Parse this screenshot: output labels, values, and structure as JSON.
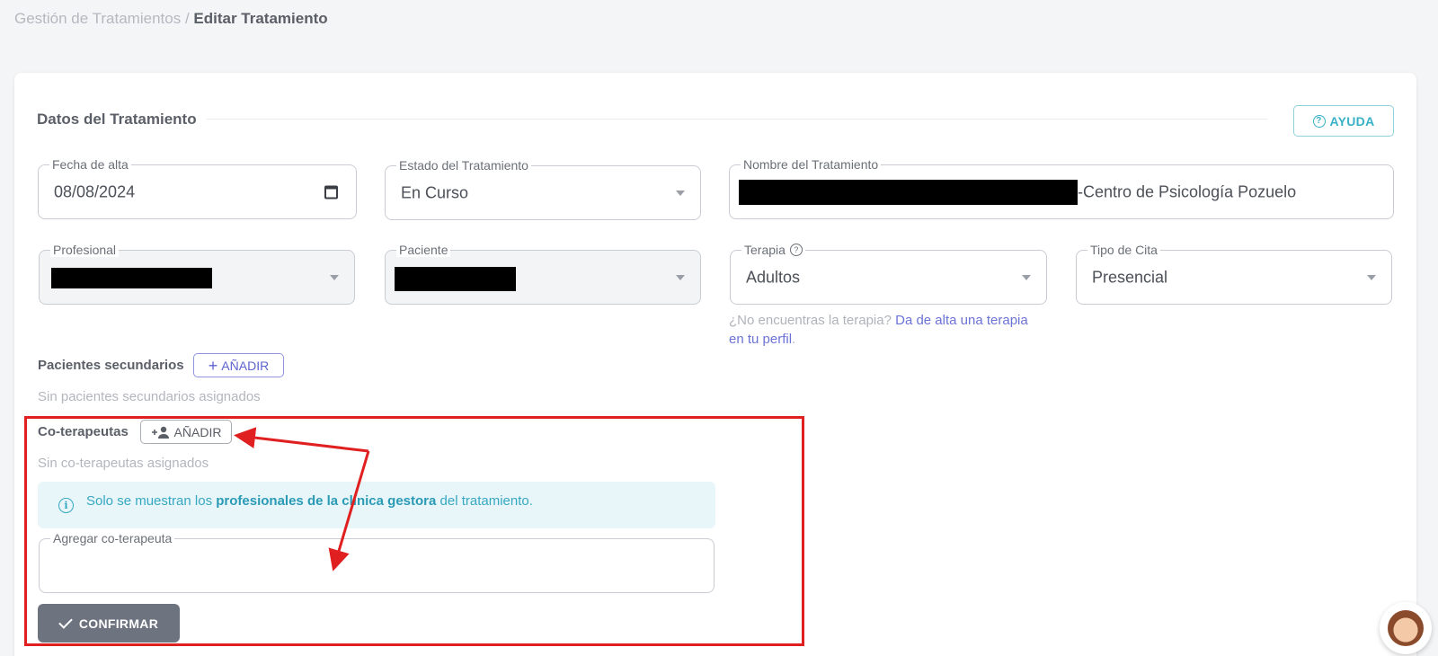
{
  "breadcrumb": {
    "parent": "Gestión de Tratamientos",
    "separator": " / ",
    "current": "Editar Tratamiento"
  },
  "section": {
    "title": "Datos del Tratamiento",
    "help_label": "AYUDA"
  },
  "fields": {
    "fecha_alta": {
      "label": "Fecha de alta",
      "value": "08/08/2024"
    },
    "estado": {
      "label": "Estado del Tratamiento",
      "value": "En Curso"
    },
    "nombre": {
      "label": "Nombre del Tratamiento",
      "value_suffix": "-Centro de Psicología Pozuelo"
    },
    "profesional": {
      "label": "Profesional"
    },
    "paciente": {
      "label": "Paciente"
    },
    "terapia": {
      "label": "Terapia",
      "value": "Adultos"
    },
    "tipo_cita": {
      "label": "Tipo de Cita",
      "value": "Presencial"
    }
  },
  "terapia_hint": {
    "text": "¿No encuentras la terapia? ",
    "link": "Da de alta una terapia en tu perfil",
    "end": "."
  },
  "secondary_patients": {
    "title": "Pacientes secundarios",
    "add_label": "AÑADIR",
    "empty": "Sin pacientes secundarios asignados"
  },
  "co_therapists": {
    "title": "Co-terapeutas",
    "add_label": "AÑADIR",
    "empty": "Sin co-terapeutas asignados",
    "info_prefix": "Solo se muestran los ",
    "info_bold": "profesionales de la clínica gestora",
    "info_suffix": " del tratamiento.",
    "add_field_label": "Agregar co-terapeuta",
    "confirm_label": "CONFIRMAR"
  },
  "colors": {
    "accent": "#5d64cf",
    "info": "#36a8c2",
    "annotation": "#e02020"
  }
}
